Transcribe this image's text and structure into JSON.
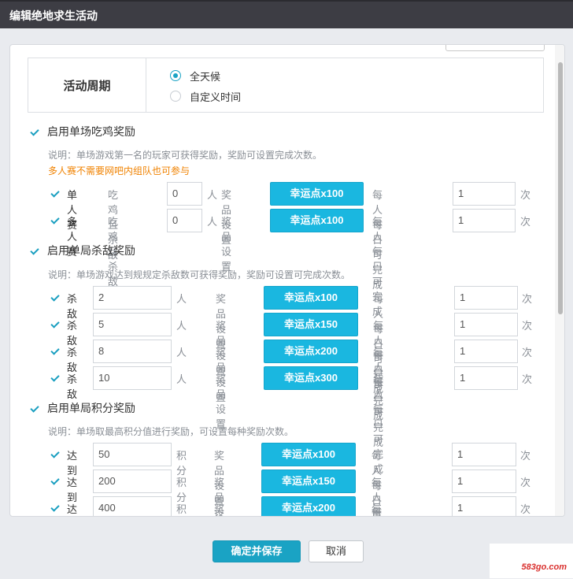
{
  "dialog": {
    "title": "编辑绝地求生活动"
  },
  "period": {
    "label": "活动周期",
    "options": [
      {
        "label": "全天候",
        "selected": true
      },
      {
        "label": "自定义时间",
        "selected": false
      }
    ]
  },
  "chicken": {
    "enabled": true,
    "header": "启用单场吃鸡奖励",
    "note": "说明：单场游戏第一名的玩家可获得奖励，奖励可设置完成次数。",
    "note2": "多人赛不需要网吧内组队也可参与",
    "rows": [
      {
        "checked": true,
        "mode": "单人赛",
        "cond_label": "吃鸡且杀敌",
        "value": "0",
        "unit": "人",
        "prize_label": "奖品设置",
        "prize": "幸运点x100",
        "limit_label": "每人每日可完成",
        "limit": "1",
        "times_unit": "次"
      },
      {
        "checked": true,
        "mode": "多人赛",
        "cond_label": "吃鸡且杀敌",
        "value": "0",
        "unit": "人",
        "prize_label": "奖品设置",
        "prize": "幸运点x100",
        "limit_label": "每人每日可完成",
        "limit": "1",
        "times_unit": "次"
      }
    ]
  },
  "kills": {
    "enabled": true,
    "header": "启用单局杀敌奖励",
    "note": "说明：单场游戏达到规规定杀敌数可获得奖励，奖励可设置可完成次数。",
    "rows": [
      {
        "checked": true,
        "label": "杀敌",
        "value": "2",
        "unit": "人",
        "prize_label": "奖品设置",
        "prize": "幸运点x100",
        "limit_label": "每人每日可完成",
        "limit": "1",
        "times_unit": "次"
      },
      {
        "checked": true,
        "label": "杀敌",
        "value": "5",
        "unit": "人",
        "prize_label": "奖品设置",
        "prize": "幸运点x150",
        "limit_label": "每人每日可完成",
        "limit": "1",
        "times_unit": "次"
      },
      {
        "checked": true,
        "label": "杀敌",
        "value": "8",
        "unit": "人",
        "prize_label": "奖品设置",
        "prize": "幸运点x200",
        "limit_label": "每人每日可完成",
        "limit": "1",
        "times_unit": "次"
      },
      {
        "checked": true,
        "label": "杀敌",
        "value": "10",
        "unit": "人",
        "prize_label": "奖品设置",
        "prize": "幸运点x300",
        "limit_label": "每人每日可完成",
        "limit": "1",
        "times_unit": "次"
      }
    ]
  },
  "score": {
    "enabled": true,
    "header": "启用单局积分奖励",
    "note": "说明：单场取最高积分值进行奖励，可设置每种奖励次数。",
    "rows": [
      {
        "checked": true,
        "label": "达到",
        "value": "50",
        "unit": "积分",
        "prize_label": "奖品设置",
        "prize": "幸运点x100",
        "limit_label": "每人每日可完成",
        "limit": "1",
        "times_unit": "次"
      },
      {
        "checked": true,
        "label": "达到",
        "value": "200",
        "unit": "积分",
        "prize_label": "奖品设置",
        "prize": "幸运点x150",
        "limit_label": "每人每日可完成",
        "limit": "1",
        "times_unit": "次"
      },
      {
        "checked": true,
        "label": "达到",
        "value": "400",
        "unit": "积分",
        "prize_label": "奖品设置",
        "prize": "幸运点x200",
        "limit_label": "每人每日可完成",
        "limit": "1",
        "times_unit": "次"
      }
    ]
  },
  "footer": {
    "save_label": "确定并保存",
    "cancel_label": "取消"
  },
  "watermark": "583go.com",
  "colors": {
    "accent": "#1aa3c4",
    "prize_button": "#1ab7e0",
    "warning_text": "#f08200",
    "titlebar": "#3d3d44"
  }
}
